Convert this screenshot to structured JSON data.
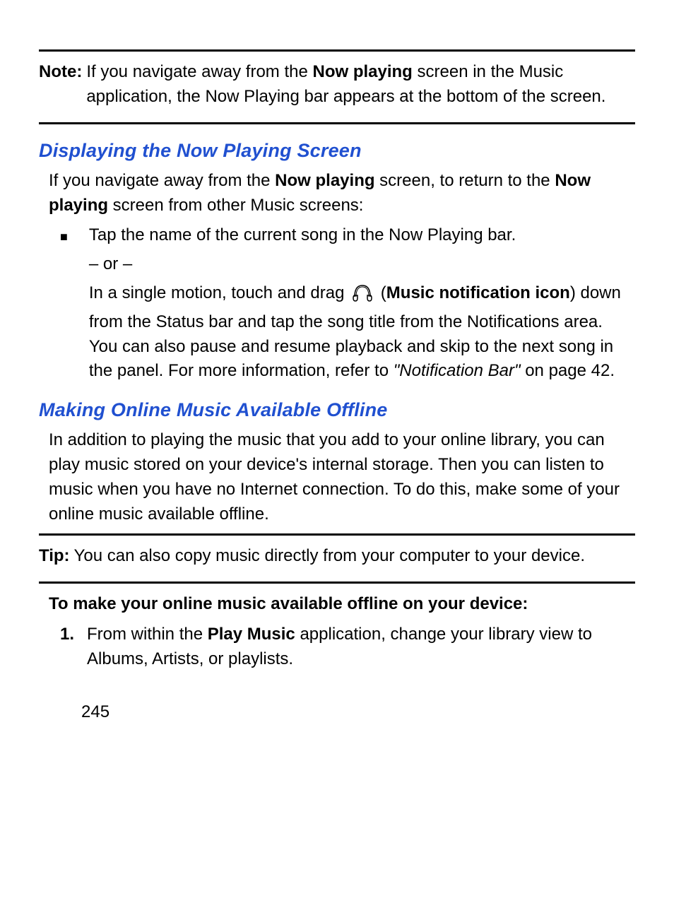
{
  "note": {
    "label": "Note:",
    "text_before": "If you navigate away from the ",
    "bold1": "Now playing",
    "text_after": " screen in the Music application, the Now Playing bar appears at the bottom of the screen."
  },
  "heading1": "Displaying the Now Playing Screen",
  "para1": {
    "t1": "If you navigate away from the ",
    "b1": "Now playing",
    "t2": " screen, to return to the ",
    "b2": "Now playing",
    "t3": " screen from other Music screens:"
  },
  "bullet": {
    "line1": "Tap the name of the current song in the Now Playing bar.",
    "or": "– or –",
    "line2": {
      "t1": "In a single motion, touch and drag ",
      "icon_label": "headphones-icon",
      "t2": " (",
      "b1": "Music notification icon",
      "t3": ") down from the Status bar and tap the song title from the Notifications area. You can also pause and resume playback and skip to the next song in the panel. For more information, refer to ",
      "i1": "\"Notification Bar\"",
      "t4": " on page 42."
    }
  },
  "heading2": "Making Online Music Available Offline",
  "para2": "In addition to playing the music that you add to your online library, you can play music stored on your device's internal storage. Then you can listen to music when you have no Internet connection. To do this, make some of your online music available offline.",
  "tip": {
    "label": "Tip:",
    "text": "You can also copy music directly from your computer to your device."
  },
  "subhead": "To make your online music available offline on your device:",
  "step1": {
    "num": "1.",
    "t1": "From within the ",
    "b1": "Play Music",
    "t2": " application, change your library view to Albums, Artists, or playlists."
  },
  "page_number": "245"
}
